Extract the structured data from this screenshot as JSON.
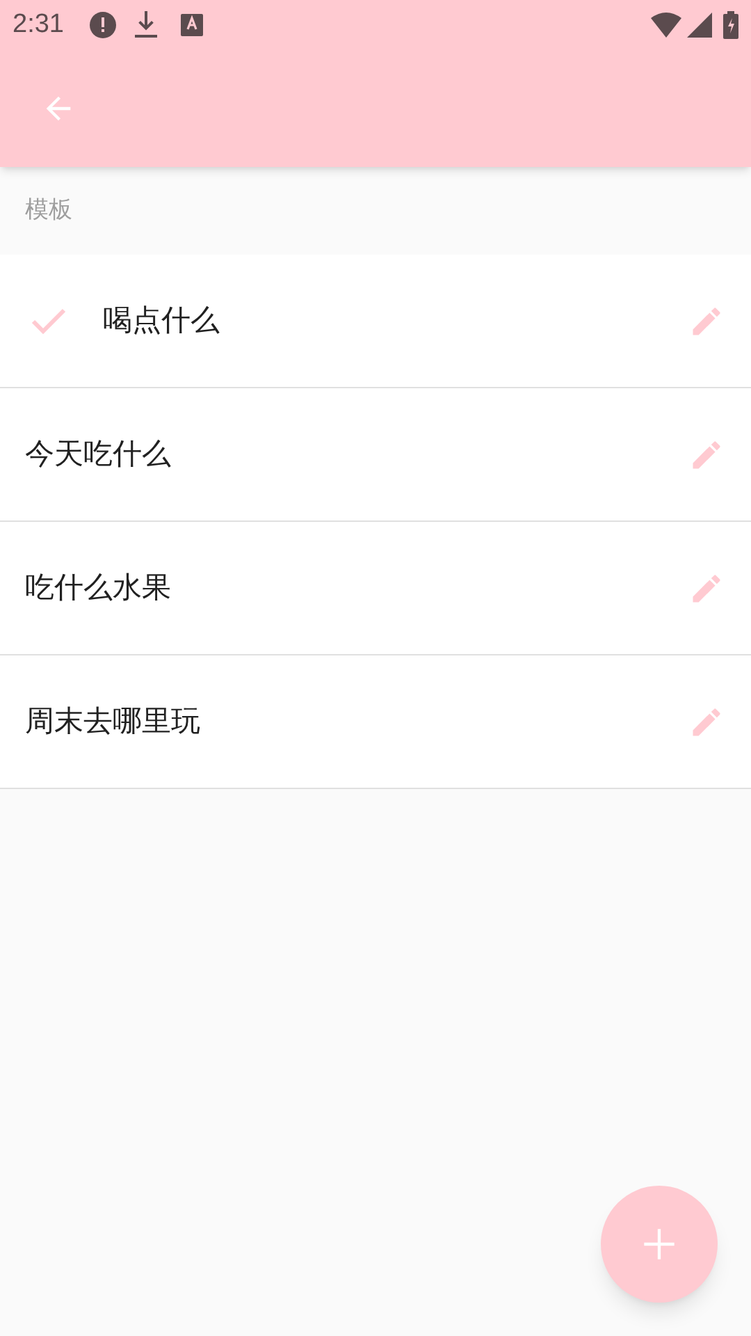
{
  "status_bar": {
    "time": "2:31"
  },
  "section": {
    "title": "模板"
  },
  "templates": [
    {
      "name": "喝点什么",
      "selected": true
    },
    {
      "name": "今天吃什么",
      "selected": false
    },
    {
      "name": "吃什么水果",
      "selected": false
    },
    {
      "name": "周末去哪里玩",
      "selected": false
    }
  ]
}
